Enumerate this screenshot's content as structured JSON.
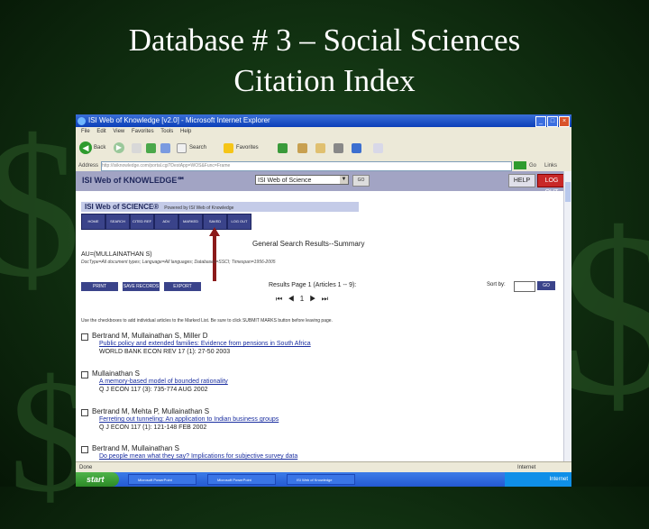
{
  "slide": {
    "title_line1": "Database # 3 – Social Sciences",
    "title_line2": "Citation Index",
    "dollar_glyph": "$"
  },
  "browser": {
    "window_title": "ISI Web of Knowledge [v2.0] - Microsoft Internet Explorer",
    "menu": [
      "File",
      "Edit",
      "View",
      "Favorites",
      "Tools",
      "Help"
    ],
    "toolbar": {
      "back_label": "Back",
      "search_label": "Search",
      "favorites_label": "Favorites"
    },
    "address_label": "Address",
    "address_value": "http://isiknowledge.com/portal.cgi?DestApp=WOS&Func=Frame",
    "go_label": "Go",
    "links_label": "Links"
  },
  "isi": {
    "logo": "ISI Web of KNOWLEDGE℠",
    "db_select_value": "ISI Web of Science",
    "go_label": "GO",
    "help_label": "HELP",
    "logout_label": "LOG OUT",
    "banner": "ISI Web of SCIENCE®",
    "banner_powered": "Powered by ISI Web of Knowledge",
    "nav_tabs": [
      "HOME",
      "SEARCH",
      "CITED REF",
      "ADV SEARCH",
      "MARKED LIST",
      "SAVED SEARCHES",
      "LOG OUT"
    ],
    "summary_title": "General Search Results--Summary",
    "query": "AU=(MULLAINATHAN S)",
    "query_sub": "DocType=All document types; Language=All languages; Databases=SSCI; Timespan=1956-2005",
    "buttons": [
      "PRINT RECORDS",
      "SAVE RECORDS",
      "EXPORT"
    ],
    "results_text": "Results Page 1 (Articles 1 -- 9):",
    "pager_text": "⏮ ◀ 1 ▶ ⏭",
    "sort_label": "Sort by:",
    "sort_go": "GO",
    "instruction": "Use the checkboxes to add individual articles to the Marked List. Be sure to click SUBMIT MARKS button before leaving page.",
    "records": [
      {
        "authors": "Bertrand M, Mullainathan S, Miller D",
        "title": "Public policy and extended families: Evidence from pensions in South Africa",
        "source": "WORLD BANK ECON REV 17 (1): 27-50 2003"
      },
      {
        "authors": "Mullainathan S",
        "title": "A memory-based model of bounded rationality",
        "source": "Q J ECON 117 (3): 735-774 AUG 2002"
      },
      {
        "authors": "Bertrand M, Mehta P, Mullainathan S",
        "title": "Ferreting out tunneling: An application to Indian business groups",
        "source": "Q J ECON 117 (1): 121-148 FEB 2002"
      },
      {
        "authors": "Bertrand M, Mullainathan S",
        "title": "Do people mean what they say? Implications for subjective survey data",
        "source": ""
      }
    ],
    "status_left": "Done",
    "status_zone": "Internet"
  },
  "taskbar": {
    "start": "start",
    "items": [
      "Microsoft PowerPoint",
      "Microsoft PowerPoint",
      "ISI Web of Knowledge"
    ],
    "clock": "Internet"
  }
}
